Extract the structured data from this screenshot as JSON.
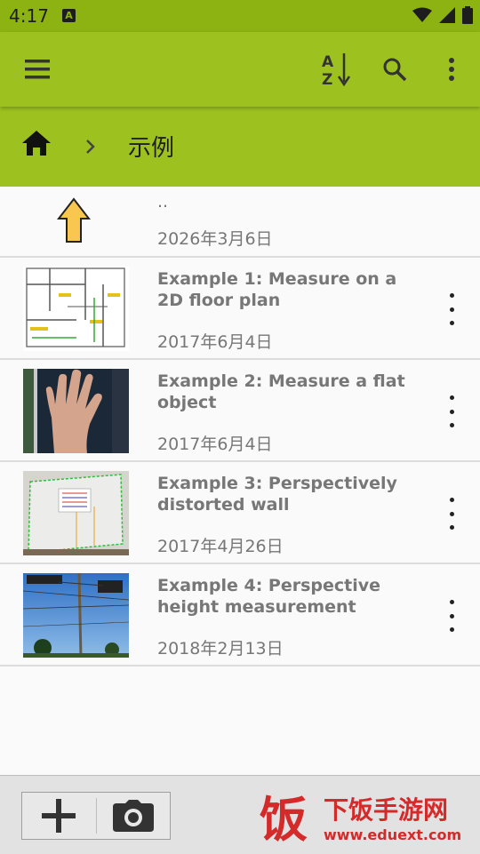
{
  "status_bar": {
    "time": "4:17",
    "notification_icon": "A"
  },
  "toolbar": {
    "menu_icon": "hamburger-menu",
    "sort_icon": "sort-az",
    "search_icon": "search",
    "overflow_icon": "more-vertical"
  },
  "breadcrumb": {
    "current": "示例"
  },
  "parent_entry": {
    "name": "..",
    "date": "2026年3月6日"
  },
  "files": [
    {
      "title": "Example 1: Measure on a 2D floor plan",
      "date": "2017年6月4日"
    },
    {
      "title": "Example 2: Measure a flat object",
      "date": "2017年6月4日"
    },
    {
      "title": "Example 3: Perspectively distorted wall",
      "date": "2017年4月26日"
    },
    {
      "title": "Example 4: Perspective height measurement",
      "date": "2018年2月13日"
    }
  ],
  "bottom_bar": {
    "add_icon": "plus",
    "camera_icon": "camera"
  },
  "watermark": {
    "text": "下饭手游网",
    "url": "www.eduext.com"
  },
  "colors": {
    "toolbar": "#9dc21f",
    "status": "#8db312",
    "accent_arrow": "#f9c74f"
  }
}
